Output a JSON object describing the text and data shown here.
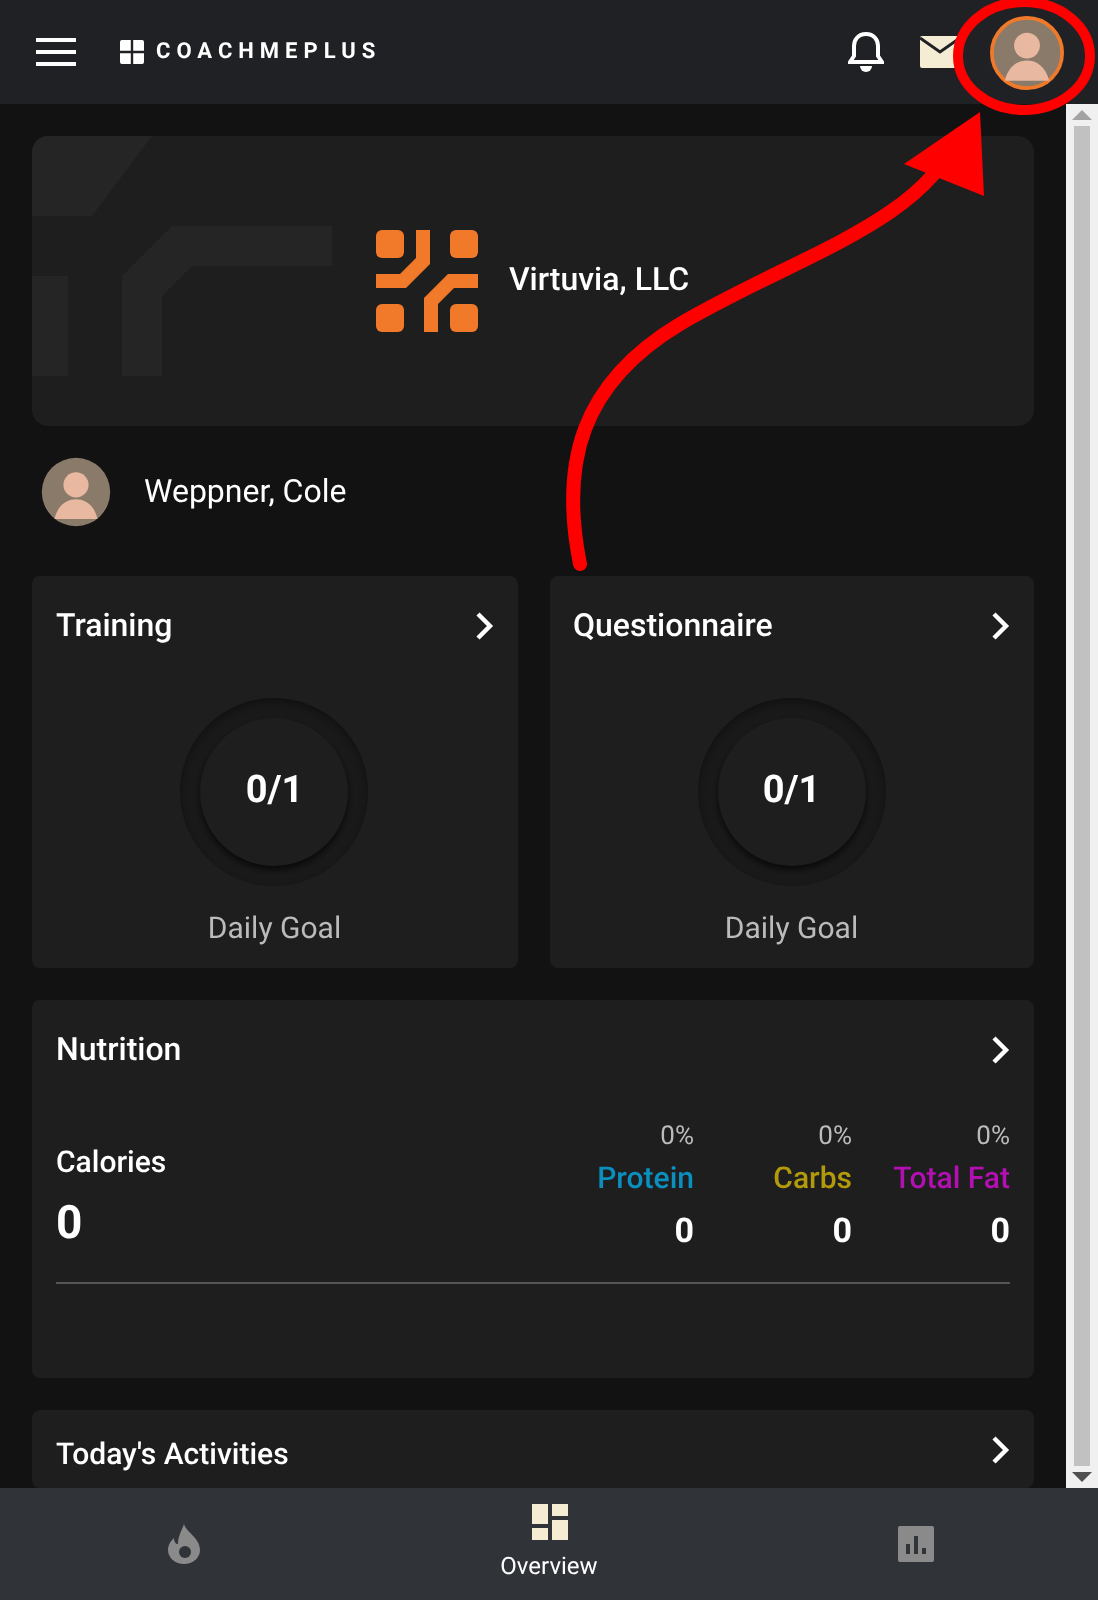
{
  "header": {
    "logo_text": "COACHMEPLUS"
  },
  "organization": {
    "name": "Virtuvia, LLC"
  },
  "profile": {
    "name": "Weppner, Cole"
  },
  "goal_cards": [
    {
      "title": "Training",
      "count": "0/1",
      "caption": "Daily Goal"
    },
    {
      "title": "Questionnaire",
      "count": "0/1",
      "caption": "Daily Goal"
    }
  ],
  "nutrition": {
    "title": "Nutrition",
    "calories_label": "Calories",
    "calories_value": "0",
    "macros": [
      {
        "percent": "0%",
        "label": "Protein",
        "color": "#0a8fbf",
        "value": "0"
      },
      {
        "percent": "0%",
        "label": "Carbs",
        "color": "#b39a0a",
        "value": "0"
      },
      {
        "percent": "0%",
        "label": "Total Fat",
        "color": "#b30fb3",
        "value": "0"
      }
    ]
  },
  "activities": {
    "title": "Today's Activities"
  },
  "bottom_nav": [
    {
      "selected": false
    },
    {
      "label": "Overview",
      "selected": true
    },
    {
      "selected": false
    }
  ]
}
